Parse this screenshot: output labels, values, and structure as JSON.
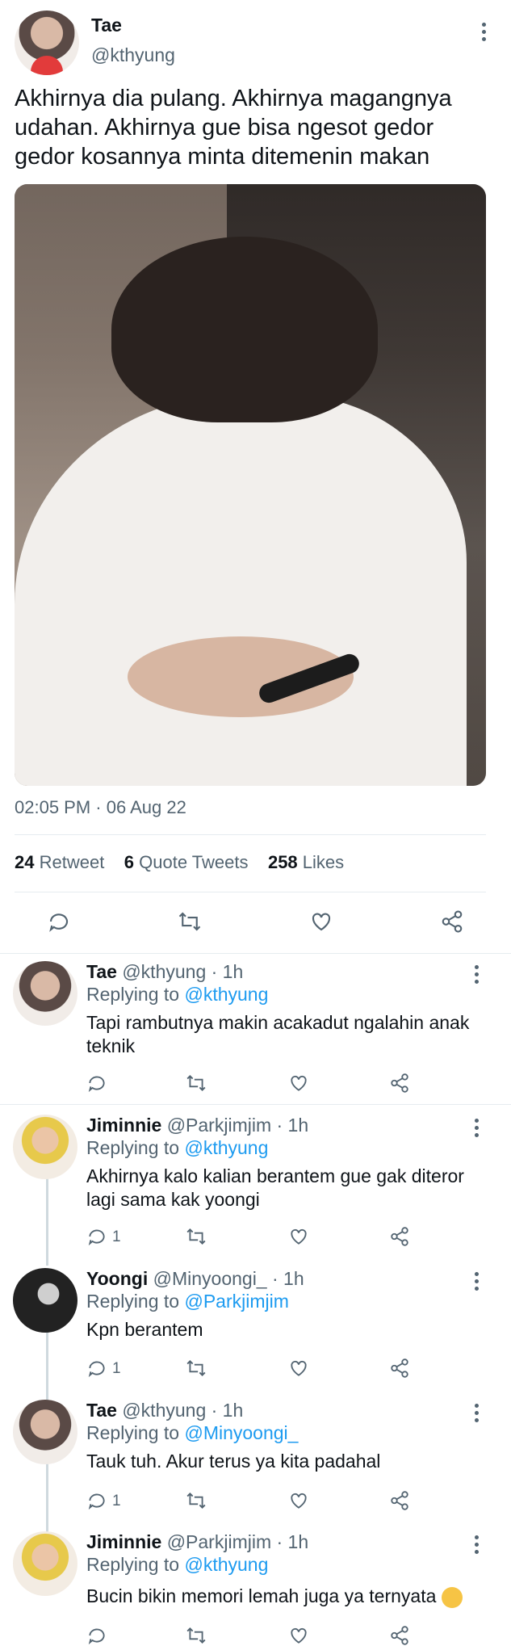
{
  "tweet": {
    "author_name": "Tae",
    "author_handle": "@kthyung",
    "text": "Akhirnya dia pulang. Akhirnya magangnya udahan. Akhirnya gue bisa ngesot gedor gedor kosannya minta ditemenin makan",
    "timestamp": "02:05 PM · 06 Aug 22",
    "stats": {
      "retweet_count": "24",
      "retweet_label": "Retweet",
      "quote_count": "6",
      "quote_label": "Quote Tweets",
      "like_count": "258",
      "like_label": "Likes"
    }
  },
  "replies": [
    {
      "name": "Tae",
      "handle": "@kthyung · 1h",
      "replying_label": "Replying to",
      "replying_to": "@kthyung",
      "text": "Tapi rambutnya makin acakadut ngalahin anak teknik",
      "reply_count": ""
    },
    {
      "name": "Jiminnie",
      "handle": "@Parkjimjim · 1h",
      "replying_label": "Replying to",
      "replying_to": "@kthyung",
      "text": "Akhirnya kalo kalian berantem gue gak diteror lagi sama kak yoongi",
      "reply_count": "1"
    },
    {
      "name": "Yoongi",
      "handle": "@Minyoongi_ · 1h",
      "replying_label": "Replying to",
      "replying_to": "@Parkjimjim",
      "text": "Kpn berantem",
      "reply_count": "1"
    },
    {
      "name": "Tae",
      "handle": "@kthyung · 1h",
      "replying_label": "Replying to",
      "replying_to": "@Minyoongi_",
      "text": "Tauk tuh. Akur terus ya kita padahal",
      "reply_count": "1"
    },
    {
      "name": "Jiminnie",
      "handle": "@Parkjimjim · 1h",
      "replying_label": "Replying to",
      "replying_to": "@kthyung",
      "text": "Bucin bikin memori lemah juga ya ternyata",
      "reply_count": ""
    }
  ],
  "icons": {
    "reply": "reply-icon",
    "retweet": "retweet-icon",
    "like": "heart-icon",
    "share": "share-icon",
    "more": "more-icon",
    "emoji": "thinking-face-emoji"
  },
  "colors": {
    "link": "#1d9bf0",
    "muted": "#536471",
    "text": "#0f1419",
    "divider": "#e6ecf0"
  }
}
